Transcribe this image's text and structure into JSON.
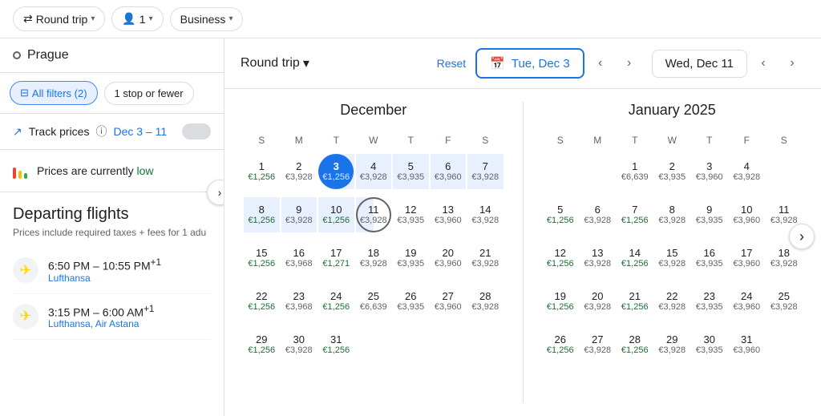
{
  "topBar": {
    "tripType": "Round trip",
    "passengers": "1",
    "cabinClass": "Business"
  },
  "sidebar": {
    "city": "Prague",
    "filters": {
      "allFilters": "All filters (2)",
      "stops": "1 stop or fewer"
    },
    "trackPrices": {
      "label": "Track prices",
      "dateRange": "Dec 3 – 11"
    },
    "pricesLow": "Prices are currently low",
    "departing": {
      "title": "Departing flights",
      "subtitle": "Prices include required taxes + fees for 1 adu",
      "flights": [
        {
          "times": "6:50 PM – 10:55 PM",
          "suffix": "+1",
          "airline": "Lufthansa"
        },
        {
          "times": "3:15 PM – 6:00 AM",
          "suffix": "+1",
          "airline": "Lufthansa, Air Astana"
        }
      ]
    }
  },
  "calendarHeader": {
    "roundTrip": "Round trip",
    "reset": "Reset",
    "departing": "Tue, Dec 3",
    "returning": "Wed, Dec 11"
  },
  "december": {
    "title": "December",
    "dows": [
      "S",
      "M",
      "T",
      "W",
      "T",
      "F",
      "S"
    ],
    "weeks": [
      [
        {
          "day": "1",
          "price": "€1,256",
          "low": true
        },
        {
          "day": "2",
          "price": "€3,928",
          "low": false
        },
        {
          "day": "3",
          "price": "€1,256",
          "low": true,
          "selected": true
        },
        {
          "day": "4",
          "price": "€3,928",
          "low": false,
          "inRange": true
        },
        {
          "day": "5",
          "price": "€3,935",
          "low": false,
          "inRange": true
        },
        {
          "day": "6",
          "price": "€3,960",
          "low": false,
          "inRange": true
        },
        {
          "day": "7",
          "price": "€3,928",
          "low": false,
          "inRange": true
        }
      ],
      [
        {
          "day": "8",
          "price": "€1,256",
          "low": true,
          "inRange": true
        },
        {
          "day": "9",
          "price": "€3,928",
          "low": false,
          "inRange": true
        },
        {
          "day": "10",
          "price": "€1,256",
          "low": true,
          "inRange": true
        },
        {
          "day": "11",
          "price": "€3,928",
          "low": false,
          "circled": true,
          "rangeEnd": true
        },
        {
          "day": "12",
          "price": "€3,935",
          "low": false
        },
        {
          "day": "13",
          "price": "€3,960",
          "low": false
        },
        {
          "day": "14",
          "price": "€3,928",
          "low": false
        }
      ],
      [
        {
          "day": "15",
          "price": "€1,256",
          "low": true
        },
        {
          "day": "16",
          "price": "€3,968",
          "low": false
        },
        {
          "day": "17",
          "price": "€1,271",
          "low": true
        },
        {
          "day": "18",
          "price": "€3,928",
          "low": false
        },
        {
          "day": "19",
          "price": "€3,935",
          "low": false
        },
        {
          "day": "20",
          "price": "€3,960",
          "low": false
        },
        {
          "day": "21",
          "price": "€3,928",
          "low": false
        }
      ],
      [
        {
          "day": "22",
          "price": "€1,256",
          "low": true
        },
        {
          "day": "23",
          "price": "€3,968",
          "low": false
        },
        {
          "day": "24",
          "price": "€1,256",
          "low": true
        },
        {
          "day": "25",
          "price": "€6,639",
          "low": false
        },
        {
          "day": "26",
          "price": "€3,935",
          "low": false
        },
        {
          "day": "27",
          "price": "€3,960",
          "low": false
        },
        {
          "day": "28",
          "price": "€3,928",
          "low": false
        }
      ],
      [
        {
          "day": "29",
          "price": "€1,256",
          "low": true
        },
        {
          "day": "30",
          "price": "€3,928",
          "low": false
        },
        {
          "day": "31",
          "price": "€1,256",
          "low": true
        },
        null,
        null,
        null,
        null
      ]
    ]
  },
  "january": {
    "title": "January 2025",
    "dows": [
      "S",
      "M",
      "T",
      "W",
      "T",
      "F",
      "S"
    ],
    "weeks": [
      [
        null,
        null,
        {
          "day": "1",
          "price": "€6,639",
          "low": false
        },
        {
          "day": "2",
          "price": "€3,935",
          "low": false
        },
        {
          "day": "3",
          "price": "€3,960",
          "low": false
        },
        {
          "day": "4",
          "price": "€3,928",
          "low": false
        },
        null
      ],
      [
        {
          "day": "5",
          "price": "€1,256",
          "low": true
        },
        {
          "day": "6",
          "price": "€3,928",
          "low": false
        },
        {
          "day": "7",
          "price": "€1,256",
          "low": true
        },
        {
          "day": "8",
          "price": "€3,928",
          "low": false
        },
        {
          "day": "9",
          "price": "€3,935",
          "low": false
        },
        {
          "day": "10",
          "price": "€3,960",
          "low": false
        },
        {
          "day": "11",
          "price": "€3,928",
          "low": false
        }
      ],
      [
        {
          "day": "12",
          "price": "€1,256",
          "low": true
        },
        {
          "day": "13",
          "price": "€3,928",
          "low": false
        },
        {
          "day": "14",
          "price": "€1,256",
          "low": true
        },
        {
          "day": "15",
          "price": "€3,928",
          "low": false
        },
        {
          "day": "16",
          "price": "€3,935",
          "low": false
        },
        {
          "day": "17",
          "price": "€3,960",
          "low": false
        },
        {
          "day": "18",
          "price": "€3,928",
          "low": false
        }
      ],
      [
        {
          "day": "19",
          "price": "€1,256",
          "low": true
        },
        {
          "day": "20",
          "price": "€3,928",
          "low": false
        },
        {
          "day": "21",
          "price": "€1,256",
          "low": true
        },
        {
          "day": "22",
          "price": "€3,928",
          "low": false
        },
        {
          "day": "23",
          "price": "€3,935",
          "low": false
        },
        {
          "day": "24",
          "price": "€3,960",
          "low": false
        },
        {
          "day": "25",
          "price": "€3,928",
          "low": false
        }
      ],
      [
        {
          "day": "26",
          "price": "€1,256",
          "low": true
        },
        {
          "day": "27",
          "price": "€3,928",
          "low": false
        },
        {
          "day": "28",
          "price": "€1,256",
          "low": true
        },
        {
          "day": "29",
          "price": "€3,928",
          "low": false
        },
        {
          "day": "30",
          "price": "€3,935",
          "low": false
        },
        {
          "day": "31",
          "price": "€3,960",
          "low": false
        },
        null
      ]
    ]
  },
  "icons": {
    "swap": "⇄",
    "chevronDown": "▾",
    "chevronLeft": "‹",
    "chevronRight": "›",
    "person": "👤",
    "calendar": "📅",
    "trendingUp": "↗",
    "info": "ⓘ",
    "filterIcon": "⊟",
    "leftArrow": "‹",
    "rightArrow": "›"
  }
}
